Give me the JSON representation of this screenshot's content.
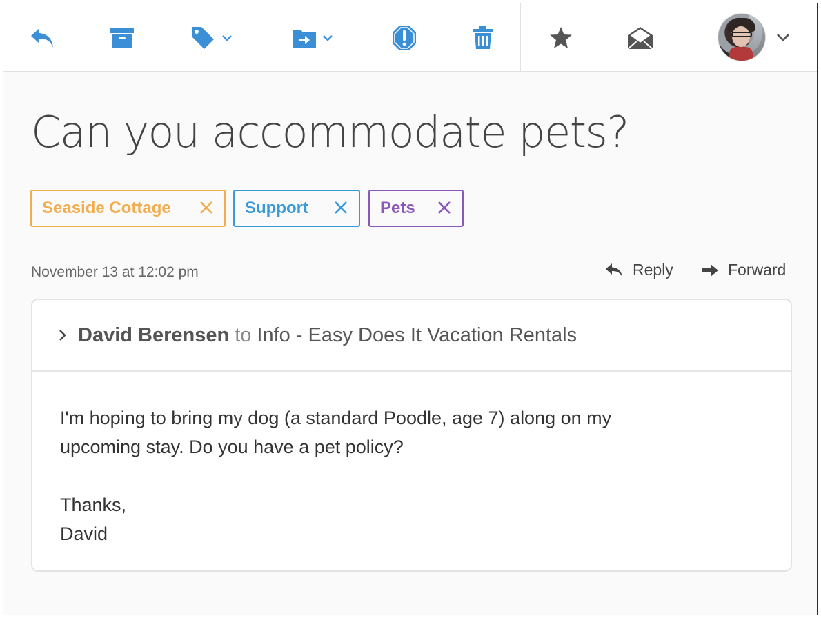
{
  "toolbar": {
    "icons": [
      "reply-icon",
      "archive-icon",
      "tag-icon",
      "move-to-folder-icon",
      "mark-spam-icon",
      "trash-icon",
      "star-icon",
      "mark-unread-icon",
      "user-avatar"
    ],
    "accent_color": "#3a8fd6",
    "secondary_color": "#555555"
  },
  "message": {
    "subject": "Can you accommodate pets?",
    "tags": [
      {
        "label": "Seaside Cottage",
        "color": "#f3ad4c"
      },
      {
        "label": "Support",
        "color": "#3a9ad9"
      },
      {
        "label": "Pets",
        "color": "#8b57b8"
      }
    ],
    "date": "November 13 at 12:02 pm",
    "reply_label": "Reply",
    "forward_label": "Forward",
    "sender": "David Berensen",
    "to_word": "to",
    "recipient": "Info - Easy Does It Vacation Rentals",
    "body": {
      "paragraph1": "I'm hoping to bring my dog (a standard Poodle, age 7) along on my upcoming stay. Do you have a pet policy?",
      "closing": "Thanks,",
      "signature": "David"
    }
  }
}
